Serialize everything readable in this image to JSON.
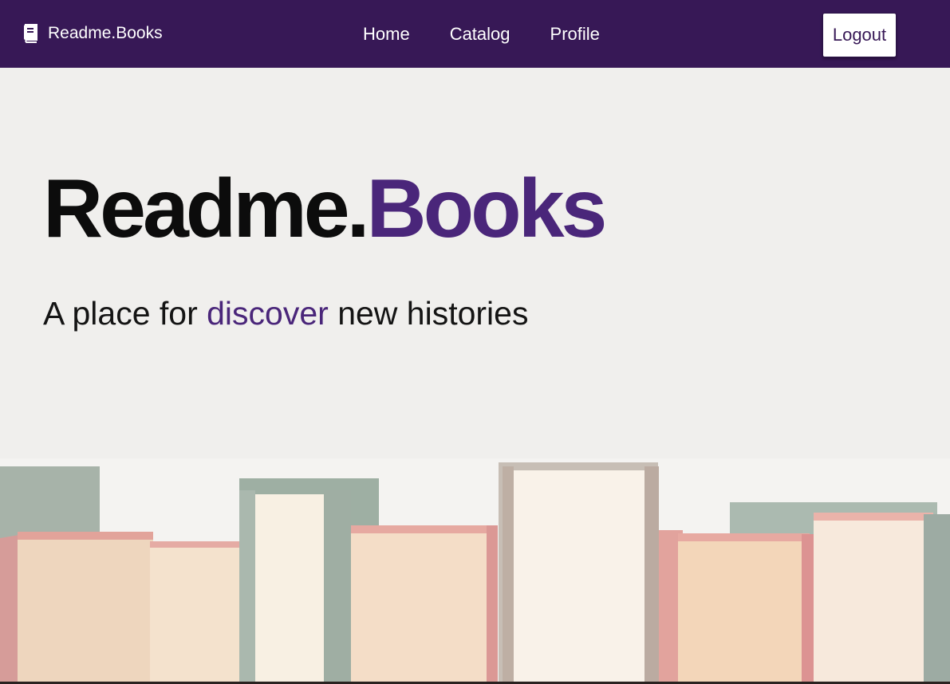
{
  "nav": {
    "brand": "Readme.Books",
    "links": [
      "Home",
      "Catalog",
      "Profile"
    ],
    "logout_label": "Logout"
  },
  "hero": {
    "title_part1": "Readme.",
    "title_part2": "Books",
    "subtitle_part1": "A place for ",
    "subtitle_accent": "discover",
    "subtitle_part2": " new histories"
  },
  "colors": {
    "navbar": "#371856",
    "accent": "#4a267a",
    "background": "#f0efed"
  },
  "icons": {
    "brand": "book-icon"
  }
}
